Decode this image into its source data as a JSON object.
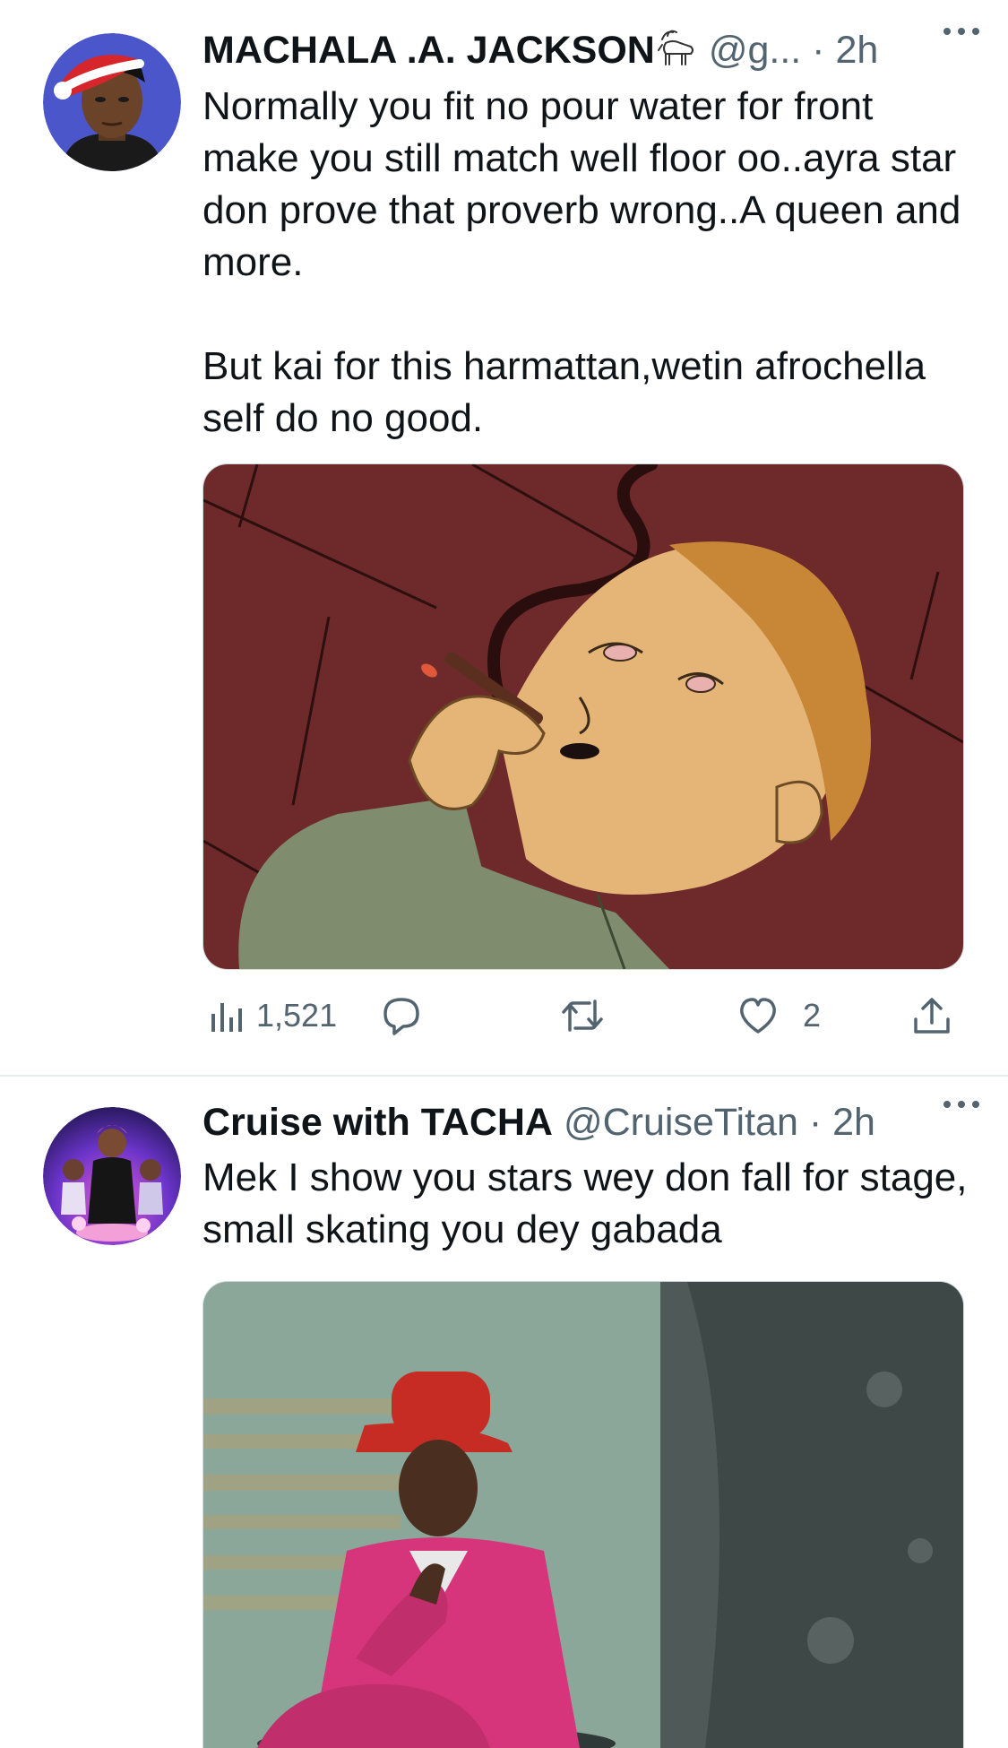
{
  "tweets": [
    {
      "author": {
        "name": "MACHALA .A. JACKSON",
        "handle": "@g...",
        "separator": "·",
        "time": "2h",
        "name_emoji": "goat"
      },
      "text_paragraphs": [
        "Normally you fit no pour water for front make you still match well floor oo..ayra star don prove that  proverb  wrong..A queen and more.",
        "But kai for this harmattan,wetin afrochella self do no good."
      ],
      "media": {
        "kind": "cartoon-image",
        "subject": "cartoon character smoking"
      },
      "actions": {
        "views": "1,521",
        "replies": "",
        "retweets": "",
        "likes": "2"
      }
    },
    {
      "author": {
        "name": "Cruise with TACHA",
        "handle": "@CruiseTitan",
        "separator": "·",
        "time": "2h"
      },
      "text": "Mek I show you stars wey don fall for stage,  small skating you dey gabada",
      "media": {
        "kind": "photo",
        "subject": "man in pink suit and red hat"
      }
    }
  ],
  "icons": [
    "more-icon",
    "views-icon",
    "reply-icon",
    "retweet-icon",
    "like-icon",
    "share-icon",
    "goat-icon"
  ],
  "colors": {
    "text": "#0f1419",
    "secondary": "#536471",
    "separator": "#e6ecf0",
    "avatar1_bg": "#4a56c9",
    "cartoon_bg": "#6e2a2a",
    "pink_suit": "#d6357c",
    "red_hat": "#c62b24"
  }
}
